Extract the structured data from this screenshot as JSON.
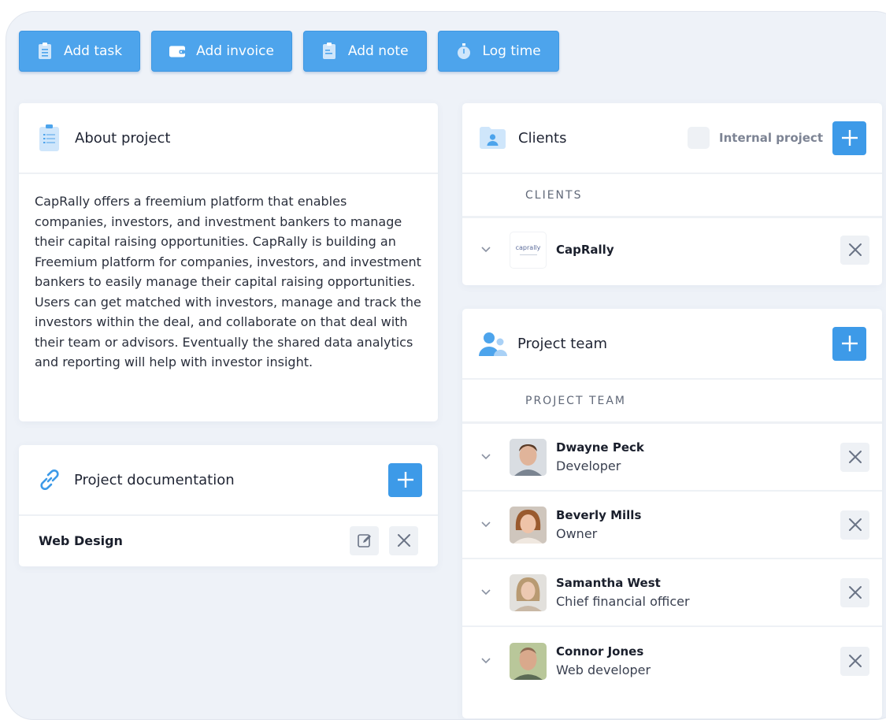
{
  "toolbar": {
    "add_task": "Add task",
    "add_invoice": "Add invoice",
    "add_note": "Add note",
    "log_time": "Log time"
  },
  "about": {
    "title": "About project",
    "text": "CapRally offers a freemium platform that enables companies, investors, and investment bankers to manage their capital raising opportunities. CapRally is building an Freemium platform for companies, investors, and investment bankers to easily manage their capital raising opportunities. Users can get matched with investors, manage and track the investors within the deal, and collaborate on that deal with their team or advisors. Eventually the shared data analytics and reporting will help with investor insight."
  },
  "documentation": {
    "title": "Project documentation",
    "items": [
      {
        "name": "Web Design"
      }
    ]
  },
  "clients": {
    "title": "Clients",
    "internal_label": "Internal project",
    "section_label": "CLIENTS",
    "items": [
      {
        "name": "CapRally",
        "logo_text": "caprally"
      }
    ]
  },
  "team": {
    "title": "Project team",
    "section_label": "PROJECT TEAM",
    "members": [
      {
        "name": "Dwayne Peck",
        "role": "Developer"
      },
      {
        "name": "Beverly Mills",
        "role": "Owner"
      },
      {
        "name": "Samantha West",
        "role": "Chief financial officer"
      },
      {
        "name": "Connor Jones",
        "role": "Web developer"
      }
    ]
  },
  "colors": {
    "accent": "#3d9ae8",
    "toolbar_button": "#4da4ec",
    "background": "#eef2f8"
  }
}
